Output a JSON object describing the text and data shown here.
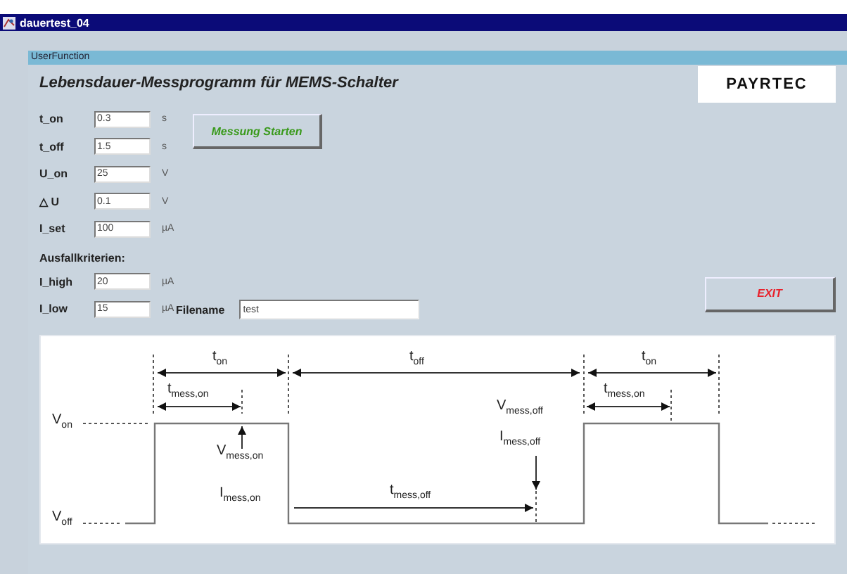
{
  "window": {
    "title": "dauertest_04"
  },
  "panel": {
    "title": "UserFunction",
    "heading": "Lebensdauer-Messprogramm für MEMS-Schalter",
    "logo": "PAYRTEC"
  },
  "parameters": [
    {
      "label": "t_on",
      "value": "0.3",
      "unit": "s"
    },
    {
      "label": "t_off",
      "value": "1.5",
      "unit": "s"
    },
    {
      "label": "U_on",
      "value": "25",
      "unit": "V"
    },
    {
      "label": "△ U",
      "value": "0.1",
      "unit": "V"
    },
    {
      "label": "I_set",
      "value": "100",
      "unit": "µA"
    }
  ],
  "start_button": "Messung Starten",
  "criteria": {
    "heading": "Ausfallkriterien:",
    "items": [
      {
        "label": "I_high",
        "value": "20",
        "unit": "µA"
      },
      {
        "label": "I_low",
        "value": "15",
        "unit": "µA"
      }
    ]
  },
  "filename": {
    "label": "Filename",
    "value": "test"
  },
  "exit_button": "EXIT",
  "diagram": {
    "labels": [
      "t$_{on}$",
      "t$_{off}$",
      "t$_{on}$",
      "t$_{mess,on}$",
      "t$_{mess,on}$",
      "V$_{on}$",
      "V$_{mess,off}$",
      "V$_{mess,on}$",
      "I$_{mess,off}$",
      "I$_{mess,on}$",
      "t$_{mess,off}$",
      "V$_{off}$"
    ]
  }
}
